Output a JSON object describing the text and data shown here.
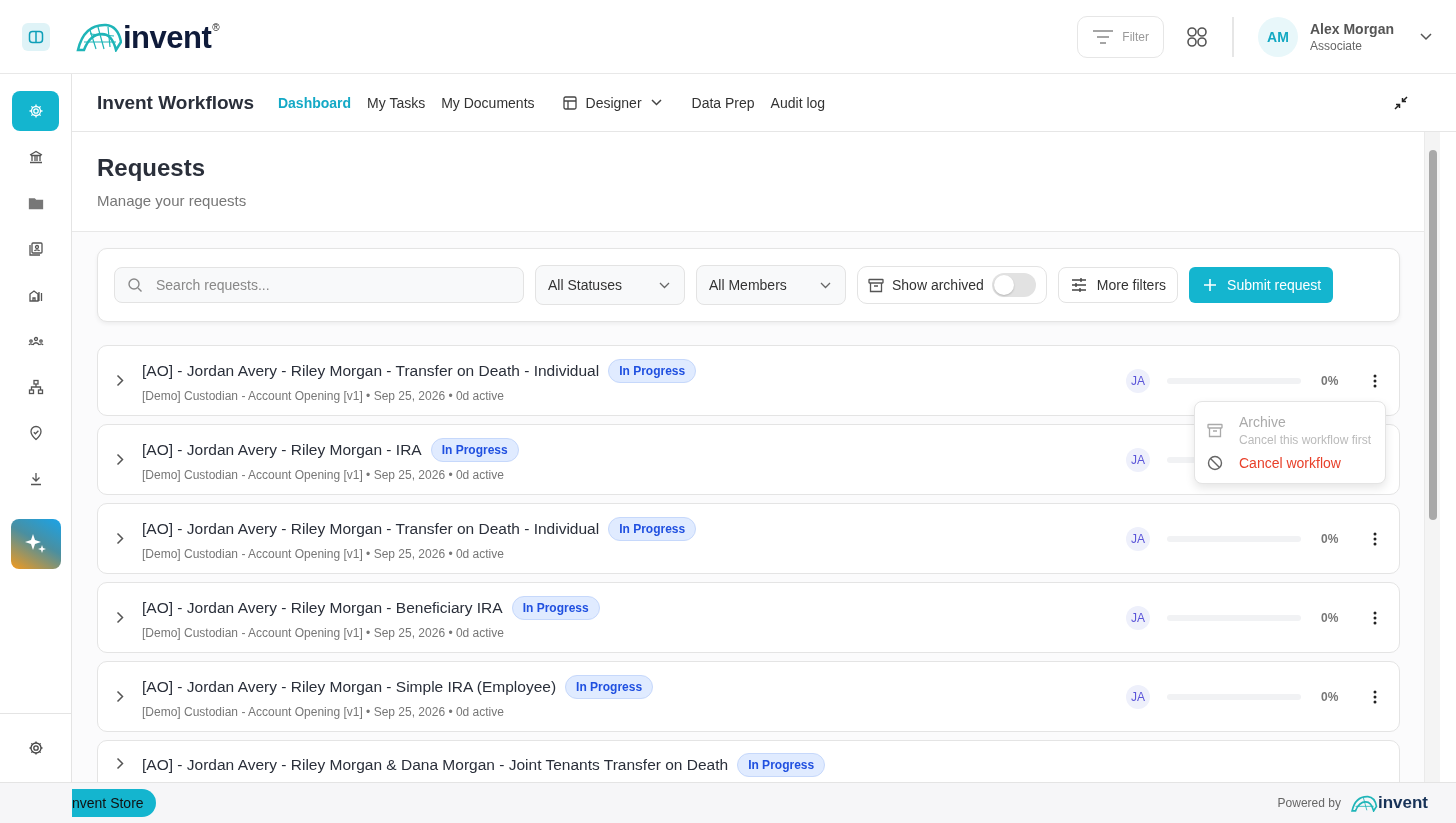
{
  "header": {
    "logo_text": "invent",
    "logo_mark": "®",
    "filter_button": "Filter",
    "user": {
      "initials": "AM",
      "name": "Alex Morgan",
      "role": "Associate"
    }
  },
  "sidebar": {
    "items": [
      {
        "selected": true
      },
      {
        "selected": false
      },
      {
        "selected": false
      },
      {
        "selected": false
      },
      {
        "selected": false
      },
      {
        "selected": false
      },
      {
        "selected": false
      },
      {
        "selected": false
      },
      {
        "selected": false
      }
    ]
  },
  "app_nav": {
    "title": "Invent Workflows",
    "items": [
      {
        "label": "Dashboard",
        "selected": true,
        "kind": "link"
      },
      {
        "label": "My Tasks",
        "selected": false,
        "kind": "link"
      },
      {
        "label": "My Documents",
        "selected": false,
        "kind": "link"
      },
      {
        "label": "Designer",
        "selected": false,
        "kind": "dropdown"
      },
      {
        "label": "Data Prep",
        "selected": false,
        "kind": "link"
      },
      {
        "label": "Audit log",
        "selected": false,
        "kind": "link"
      }
    ]
  },
  "page": {
    "title": "Requests",
    "subtitle": "Manage your requests"
  },
  "toolbar": {
    "search_placeholder": "Search requests...",
    "status_select": "All Statuses",
    "member_select": "All Members",
    "show_archived": {
      "label": "Show archived",
      "on": false
    },
    "more_filters": "More filters",
    "submit": "Submit request"
  },
  "requests": [
    {
      "title": "[AO] - Jordan Avery - Riley Morgan - Transfer on Death - Individual",
      "status": "In Progress",
      "meta": "[Demo] Custodian - Account Opening [v1] • Sep 25, 2026 • 0d active",
      "assignee": "JA",
      "level": 0,
      "percent": "0%"
    },
    {
      "title": "[AO] - Jordan Avery - Riley Morgan - IRA",
      "status": "In Progress",
      "meta": "[Demo] Custodian - Account Opening [v1] • Sep 25, 2026 • 0d active",
      "assignee": "JA",
      "level": 0
    },
    {
      "title": "[AO] - Jordan Avery - Riley Morgan - Transfer on Death - Individual",
      "status": "In Progress",
      "meta": "[Demo] Custodian - Account Opening [v1] • Sep 25, 2026 • 0d active",
      "assignee": "JA",
      "level": 0,
      "percent": "0%"
    },
    {
      "title": "[AO] - Jordan Avery - Riley Morgan - Beneficiary IRA",
      "status": "In Progress",
      "meta": "[Demo] Custodian - Account Opening [v1] • Sep 25, 2026 • 0d active",
      "assignee": "JA",
      "level": 0,
      "percent": "0%"
    },
    {
      "title": "[AO] - Jordan Avery - Riley Morgan - Simple IRA (Employee)",
      "status": "In Progress",
      "meta": "[Demo] Custodian - Account Opening [v1] • Sep 25, 2026 • 0d active",
      "assignee": "JA",
      "level": 0,
      "percent": "0%"
    },
    {
      "title": "[AO] - Jordan Avery - Riley Morgan & Dana Morgan - Joint Tenants Transfer on Death",
      "status": "In Progress"
    }
  ],
  "row_menu": {
    "items": [
      {
        "label": "Archive",
        "hint": "Cancel this workflow first",
        "disabled": true,
        "kind": "archive"
      },
      {
        "label": "Cancel workflow",
        "disabled": false,
        "kind": "cancel"
      }
    ]
  },
  "footer": {
    "store_button": "nvent Store",
    "powered_by": "Powered by",
    "logo_text": "invent"
  }
}
